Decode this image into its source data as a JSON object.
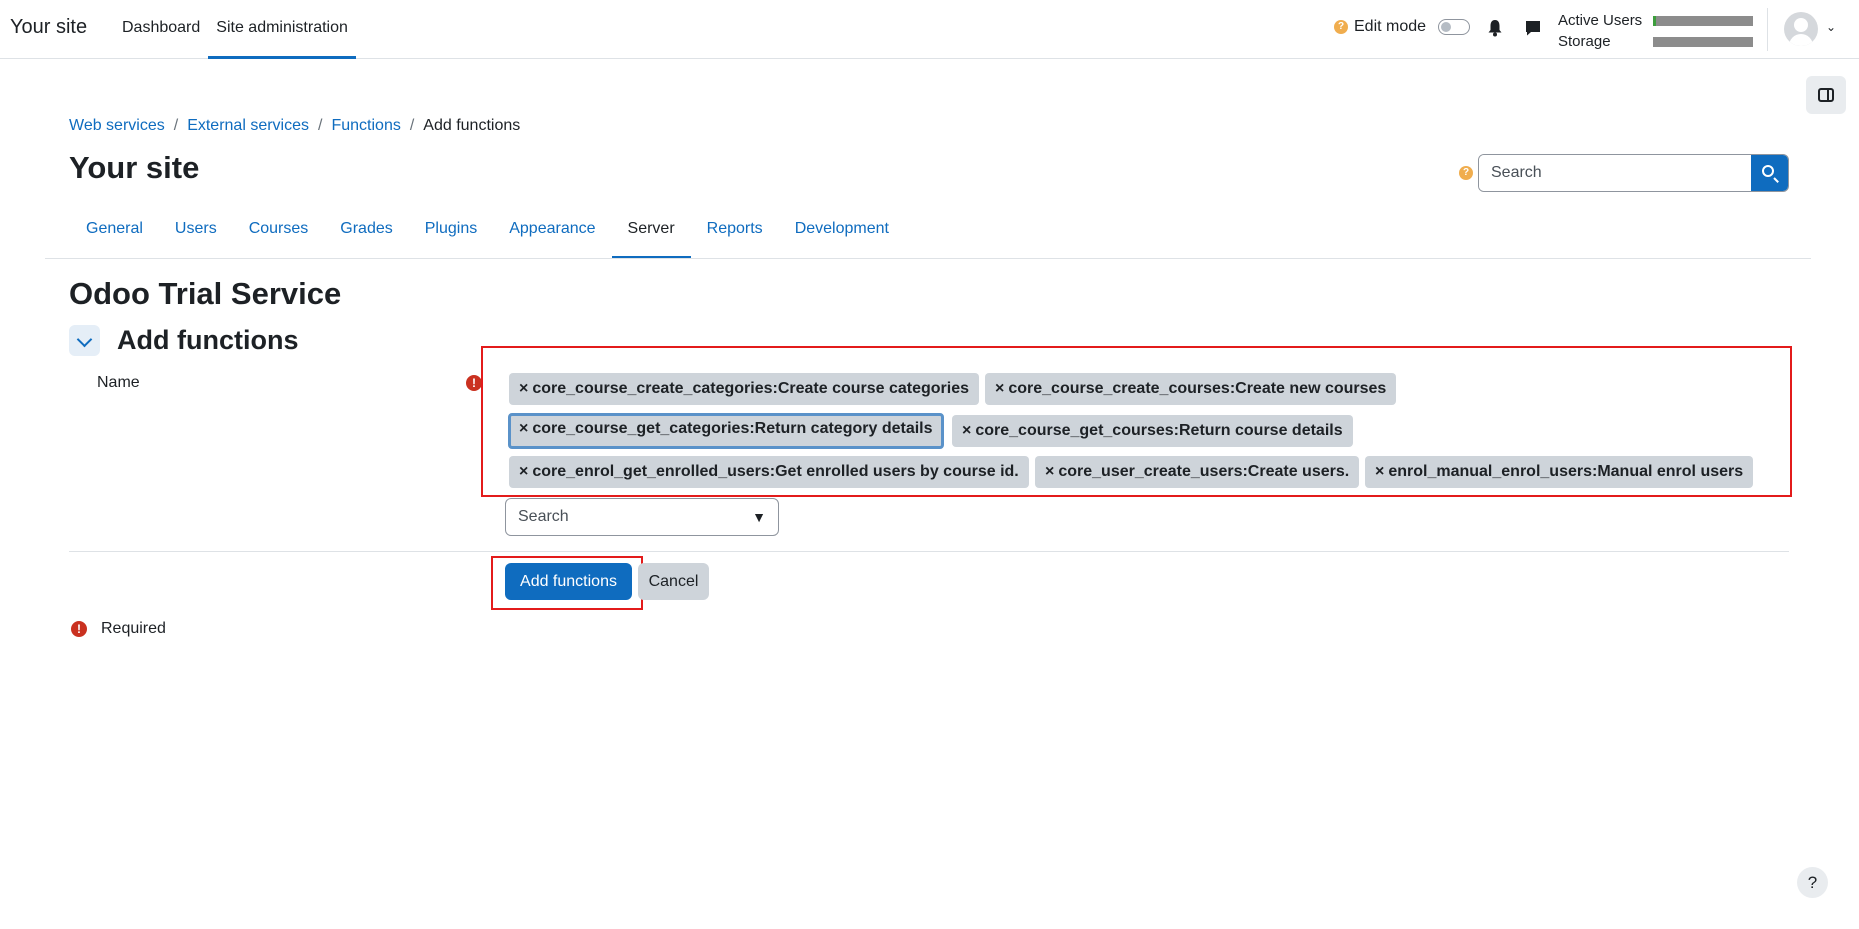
{
  "navbar": {
    "brand": "Your site",
    "links": [
      "Dashboard",
      "Site administration"
    ],
    "edit_mode_label": "Edit mode",
    "help_glyph": "?",
    "stats": {
      "active_users_label": "Active Users",
      "storage_label": "Storage"
    }
  },
  "breadcrumb": {
    "items": [
      "Web services",
      "External services",
      "Functions"
    ],
    "separator": "/",
    "current": "Add functions"
  },
  "site_title": "Your site",
  "admin_search": {
    "placeholder": "Search"
  },
  "admin_tabs": [
    "General",
    "Users",
    "Courses",
    "Grades",
    "Plugins",
    "Appearance",
    "Server",
    "Reports",
    "Development"
  ],
  "active_tab": "Server",
  "service_title": "Odoo Trial Service",
  "section_title": "Add functions",
  "field_label": "Name",
  "selected_functions": [
    "core_course_create_categories:Create course categories",
    "core_course_create_courses:Create new courses",
    "core_course_get_categories:Return category details",
    "core_course_get_courses:Return course details",
    "core_enrol_get_enrolled_users:Get enrolled users by course id.",
    "core_user_create_users:Create users.",
    "enrol_manual_enrol_users:Manual enrol users"
  ],
  "chip_remove_glyph": "×",
  "function_search": {
    "placeholder": "Search",
    "arrow": "▼"
  },
  "buttons": {
    "submit": "Add functions",
    "cancel": "Cancel"
  },
  "required_note": "Required",
  "required_glyph": "!",
  "help_fab": "?",
  "colors": {
    "primary": "#0f6cbf",
    "highlight": "#e31b1b",
    "required": "#ca3120"
  }
}
